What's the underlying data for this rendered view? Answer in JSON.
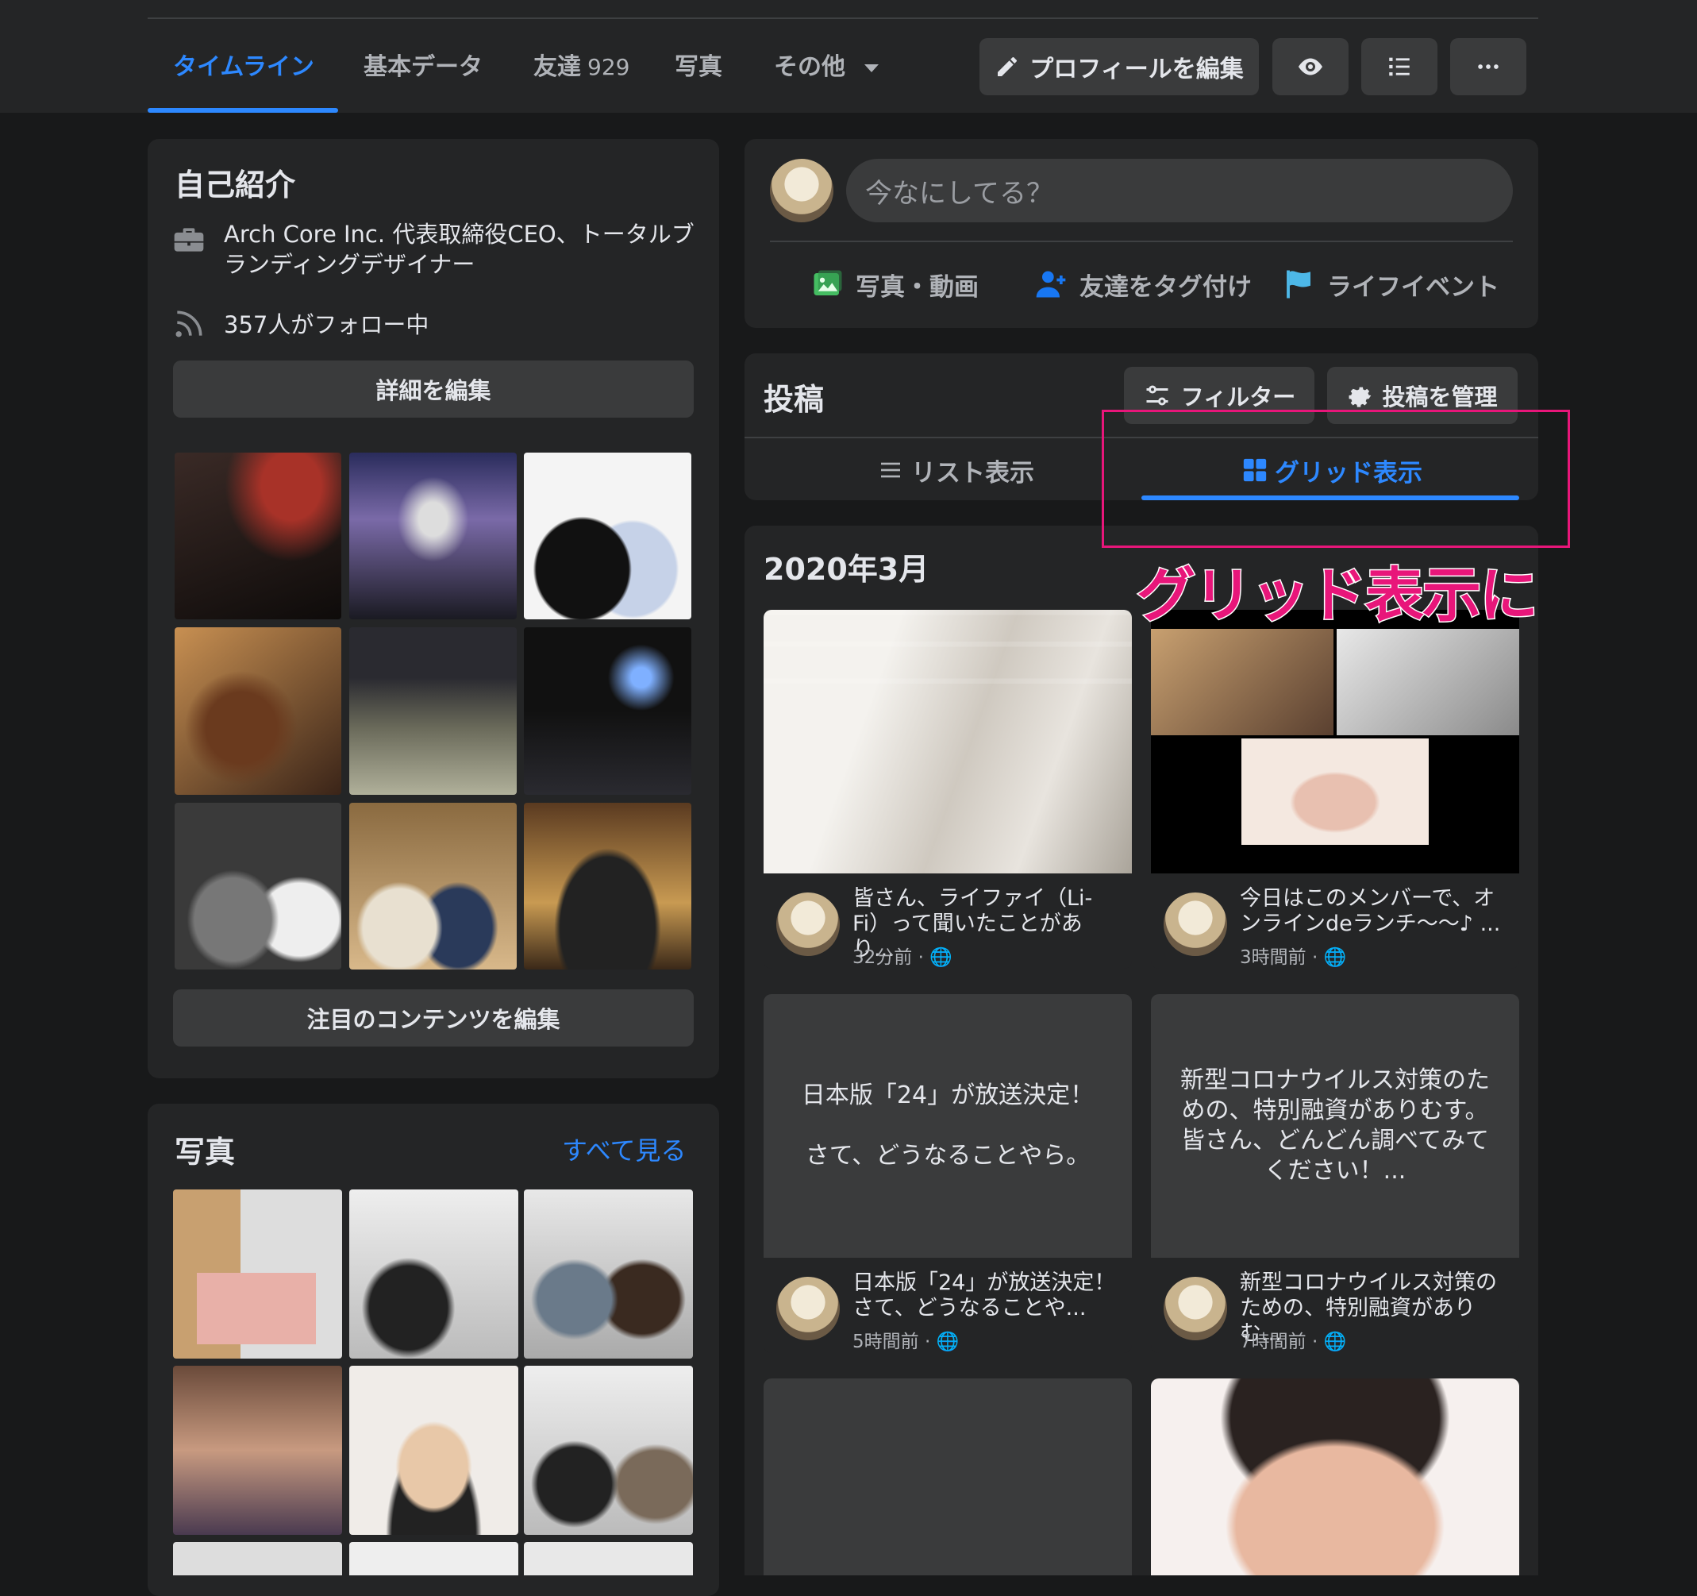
{
  "nav": {
    "tabs": [
      {
        "label": "タイムライン"
      },
      {
        "label": "基本データ"
      },
      {
        "label": "友達",
        "count": "929"
      },
      {
        "label": "写真"
      },
      {
        "label": "その他"
      }
    ],
    "edit_profile": "プロフィールを編集"
  },
  "intro": {
    "title": "自己紹介",
    "work": "Arch Core Inc. 代表取締役CEO、トータルブランディングデザイナー",
    "followers": "357人がフォロー中",
    "edit_details": "詳細を編集",
    "edit_featured": "注目のコンテンツを編集"
  },
  "photos": {
    "title": "写真",
    "see_all": "すべて見る"
  },
  "composer": {
    "placeholder": "今なにしてる？",
    "actions": [
      "写真・動画",
      "友達をタグ付け",
      "ライフイベント"
    ]
  },
  "posts": {
    "title": "投稿",
    "filter": "フィルター",
    "manage": "投稿を管理",
    "list_view": "リスト表示",
    "grid_view": "グリッド表示",
    "month": "2020年3月",
    "items": [
      {
        "text": "皆さん、ライファイ（Li-Fi）って聞いたことがあり...",
        "time": "32分前 ·"
      },
      {
        "text": "今日はこのメンバーで、オンラインdeランチ〜〜♪ ...",
        "time": "3時間前 ·"
      },
      {
        "body": "日本版「24」が放送決定！\n\nさて、どうなることやら。",
        "text": "日本版「24」が放送決定！\nさて、どうなることや...",
        "time": "5時間前 ·"
      },
      {
        "body": "新型コロナウイルス対策のための、特別融資がありむす。\n皆さん、どんどん調べてみてください！...",
        "text": "新型コロナウイルス対策のための、特別融資がありむ...",
        "time": "7時間前 ·"
      }
    ]
  },
  "annotation": "グリッド表示に",
  "colors": {
    "accent": "#2d88ff",
    "annotation": "#e8167a",
    "bg": "#18191a",
    "card": "#242526"
  }
}
